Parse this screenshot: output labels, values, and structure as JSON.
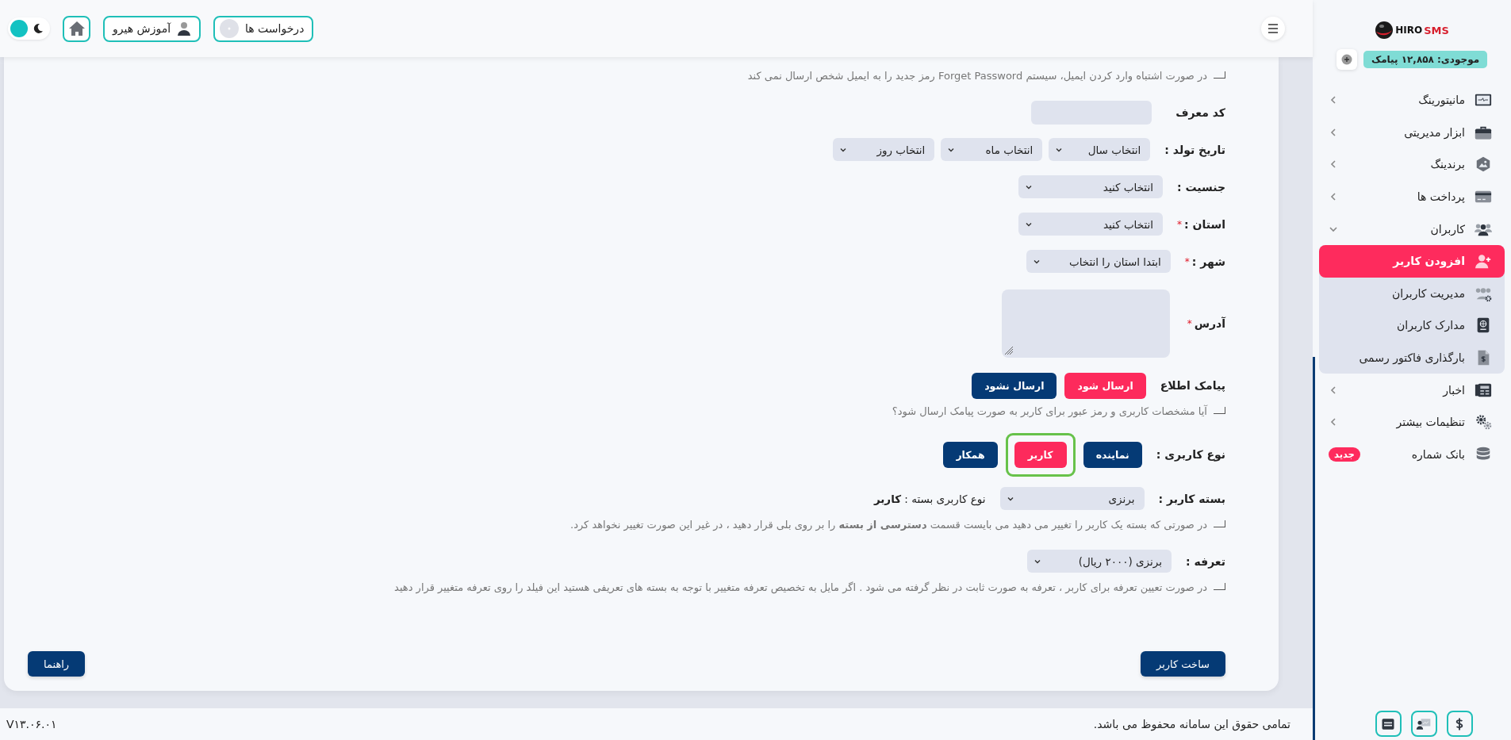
{
  "topbar": {
    "theme_toggle": {
      "on": false
    },
    "buttons": [
      {
        "kind": "requests",
        "label": "درخواست ها"
      },
      {
        "kind": "tutorial",
        "label": "آموزش هیرو"
      },
      {
        "kind": "home"
      }
    ]
  },
  "sidebar": {
    "logo": {
      "word1": "HIRO",
      "word2": "SMS"
    },
    "balance": "موجودی: ۱۲,۸۵۸ پیامک",
    "items": [
      {
        "label": "مانیتورینگ",
        "expanded": false,
        "selected": false
      },
      {
        "label": "ابزار مدیریتی",
        "expanded": false,
        "selected": false
      },
      {
        "label": "برندینگ",
        "expanded": false,
        "selected": false
      },
      {
        "label": "پرداخت ها",
        "expanded": false,
        "selected": false
      },
      {
        "label": "کاربران",
        "expanded": true,
        "selected": false,
        "children": [
          {
            "label": "افزودن کاربر",
            "selected": true
          },
          {
            "label": "مدیریت کاربران",
            "selected": false
          },
          {
            "label": "مدارک کاربران",
            "selected": false
          },
          {
            "label": "بارگذاری فاکتور رسمی",
            "selected": false
          }
        ]
      },
      {
        "label": "اخبار",
        "expanded": false,
        "selected": false
      },
      {
        "label": "تنظیمات بیشتر",
        "expanded": false,
        "selected": false
      },
      {
        "label": "بانک شماره",
        "selected": false,
        "badge": "جدید"
      }
    ]
  },
  "form": {
    "rows": [
      {
        "kind": "note",
        "text": "در صورت اشتباه وارد کردن ایمیل، سیستم Forget Password رمز جدید را به ایمیل شخص ارسال نمی کند"
      },
      {
        "kind": "input",
        "label": "کد معرف"
      },
      {
        "kind": "selects",
        "label": "تاریخ تولد :",
        "options": [
          "انتخاب سال",
          "انتخاب ماه",
          "انتخاب روز"
        ]
      },
      {
        "kind": "select",
        "label": "جنسیت :",
        "value": "انتخاب کنید"
      },
      {
        "kind": "select",
        "label": "استان :",
        "value": "انتخاب کنید",
        "required_mark": "*"
      },
      {
        "kind": "select",
        "label": "شهر :",
        "value": "ابتدا استان را انتخاب",
        "required_mark": "*"
      },
      {
        "kind": "textarea",
        "label": "آدرس",
        "required_mark": "*"
      },
      {
        "kind": "choice",
        "label": "پیامک اطلاع",
        "options": [
          {
            "label": "ارسال شود",
            "selected": true,
            "focused": false
          },
          {
            "label": "ارسال نشود",
            "selected": false,
            "focused": false
          }
        ]
      },
      {
        "kind": "note",
        "text": "آیا مشخصات کاربری و رمز عبور برای کاربر به صورت پیامک ارسال شود؟"
      },
      {
        "kind": "choice",
        "label": "نوع کاربری :",
        "options": [
          {
            "label": "نماینده",
            "selected": false,
            "focused": false
          },
          {
            "label": "کاربر",
            "selected": true,
            "focused": true
          },
          {
            "label": "همکار",
            "selected": false,
            "focused": false
          }
        ]
      },
      {
        "kind": "package",
        "label": "بسته کاربر :",
        "value": "برنزی",
        "info": "نوع کاربری بسته : **کاربر**"
      },
      {
        "kind": "note",
        "text": "در صورتی که بسته یک کاربر را تغییر می دهید می بایست قسمت **دسترسی از بسته** را بر روی بلی قرار دهید ، در غیر این صورت تغییر نخواهد کرد."
      },
      {
        "kind": "select",
        "label": "تعرفه :",
        "value": "برنزی (۲۰۰۰ ریال)"
      },
      {
        "kind": "note",
        "text": "در صورت تعیین تعرفه برای کاربر ، تعرفه به صورت ثابت در نظر گرفته می شود . اگر مایل به تخصیص تعرفه متغییر با توجه به بسته های تعریفی هستید این فیلد را روی تعرفه متغییر قرار دهید"
      }
    ],
    "submit": "ساخت کاربر",
    "help": "راهنما"
  },
  "footer": {
    "copyright": "تمامی حقوق این سامانه محفوظ می باشد.",
    "version": "V۱۳.۰۶.۰۱"
  }
}
